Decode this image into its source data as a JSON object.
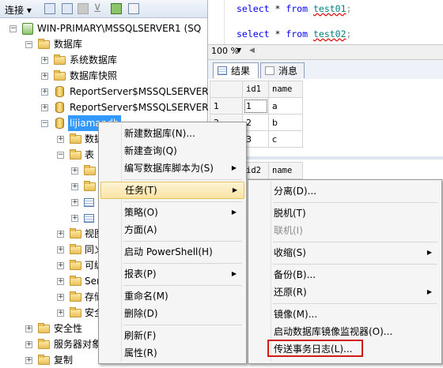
{
  "toolbar": {
    "connect_label": "连接 ▾"
  },
  "tree": {
    "server": "WIN-PRIMARY\\MSSQLSERVER1 (SQ",
    "databases": "数据库",
    "system_db": "系统数据库",
    "snapshots": "数据库快照",
    "report1": "ReportServer$MSSQLSERVER",
    "report2": "ReportServer$MSSQLSERVER",
    "selected_db": "lijiamandb",
    "partial_labels": [
      "数据",
      "表",
      "",
      "",
      "",
      "",
      "视图",
      "同义",
      "可编",
      "Ser",
      "存储",
      "安全"
    ],
    "security": "安全性",
    "server_objects": "服务器对象",
    "replication": "复制"
  },
  "editor": {
    "line1": {
      "kw1": "select",
      "star": " * ",
      "kw2": "from",
      "table": "test01"
    },
    "line2": {
      "kw1": "select",
      "star": " * ",
      "kw2": "from",
      "table": "test02"
    },
    "zoom": "100 %"
  },
  "results": {
    "tabs": [
      "结果",
      "消息"
    ],
    "table1": {
      "columns": [
        "id1",
        "name"
      ],
      "rows": [
        [
          "1",
          "1",
          "a"
        ],
        [
          "2",
          "2",
          "b"
        ],
        [
          "3",
          "3",
          "c"
        ]
      ]
    },
    "table2": {
      "columns": [
        "id2",
        "name"
      ]
    }
  },
  "context_menu": {
    "items": [
      "新建数据库(N)...",
      "新建查询(Q)",
      "编写数据库脚本为(S)",
      "任务(T)",
      "策略(O)",
      "方面(A)",
      "启动 PowerShell(H)",
      "报表(P)",
      "重命名(M)",
      "删除(D)",
      "刷新(F)",
      "属性(R)"
    ]
  },
  "submenu": {
    "items": [
      "分离(D)...",
      "脱机(T)",
      "联机(I)",
      "收缩(S)",
      "备份(B)...",
      "还原(R)",
      "镜像(M)...",
      "启动数据库镜像监视器(O)...",
      "传送事务日志(L)..."
    ]
  },
  "colors": {
    "highlight_border": "#d11a1a",
    "selection": "#3399ff",
    "menu_hover": "#fbe3a2"
  }
}
